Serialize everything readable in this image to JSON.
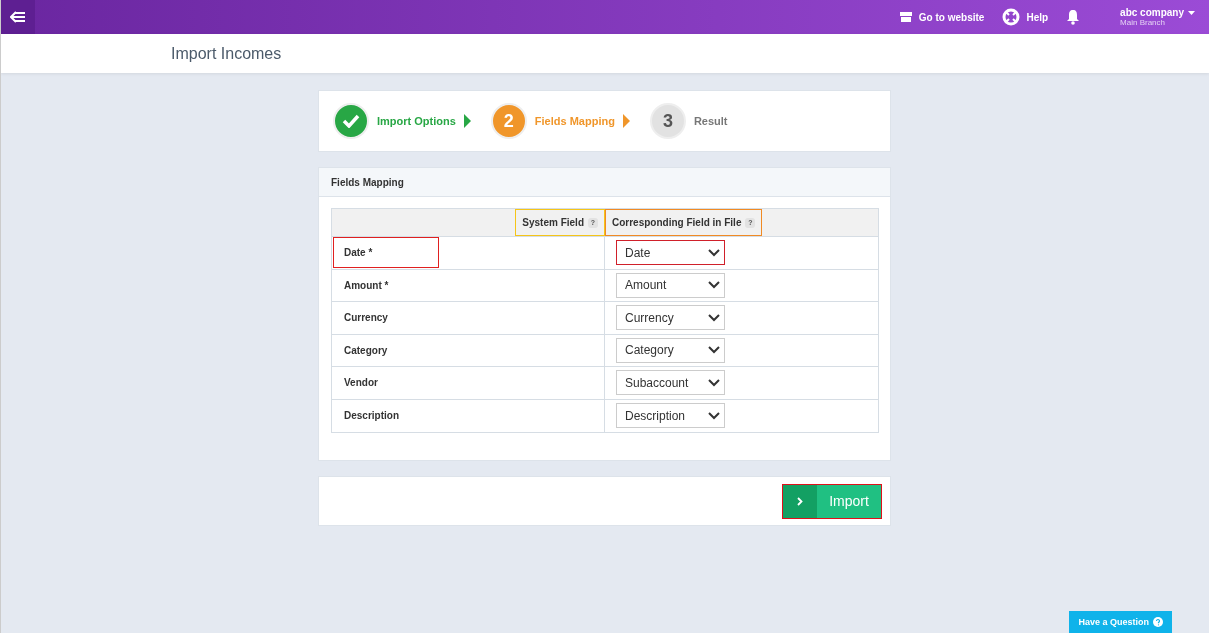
{
  "topbar": {
    "links": [
      {
        "kind": "store",
        "label": "Go to website"
      },
      {
        "kind": "help",
        "label": "Help"
      }
    ],
    "company": "abc company",
    "branch": "Main Branch"
  },
  "page_title": "Import Incomes",
  "steps": [
    {
      "completed": true,
      "selected": false,
      "label": "Import Options"
    },
    {
      "completed": false,
      "selected": true,
      "number": "2",
      "label": "Fields Mapping"
    },
    {
      "completed": false,
      "selected": false,
      "number": "3",
      "label": "Result"
    }
  ],
  "mapping": {
    "title": "Fields Mapping",
    "columns": [
      {
        "label": "System Field",
        "color": "#f5c518"
      },
      {
        "label": "Corresponding Field in File",
        "color": "#f08a24"
      }
    ],
    "help_mark": "?",
    "rows": [
      {
        "field": "Date *",
        "value": "Date",
        "highlighted": true
      },
      {
        "field": "Amount *",
        "value": "Amount",
        "highlighted": false
      },
      {
        "field": "Currency",
        "value": "Currency",
        "highlighted": false
      },
      {
        "field": "Category",
        "value": "Category",
        "highlighted": false
      },
      {
        "field": "Vendor",
        "value": "Subaccount",
        "highlighted": false
      },
      {
        "field": "Description",
        "value": "Description",
        "highlighted": false
      }
    ]
  },
  "import_button": {
    "label": "Import",
    "highlighted": true
  },
  "question_button": "Have a Question"
}
